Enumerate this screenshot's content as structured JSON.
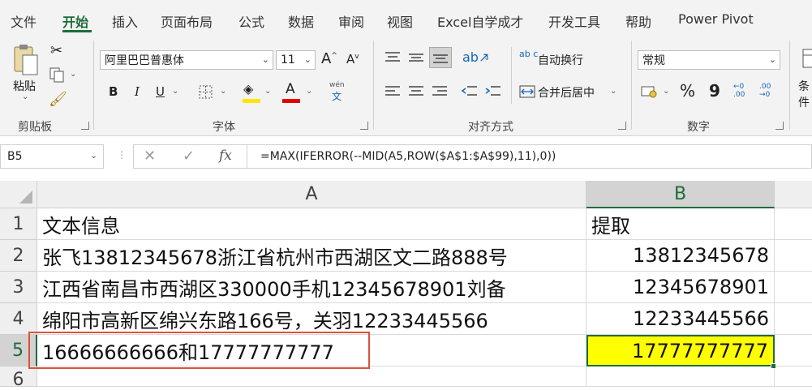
{
  "tabs": [
    "文件",
    "开始",
    "插入",
    "页面布局",
    "公式",
    "数据",
    "审阅",
    "视图",
    "Excel自学成才",
    "开发工具",
    "帮助",
    "Power Pivot"
  ],
  "clipboard": {
    "paste_label": "粘贴",
    "group_label": "剪贴板"
  },
  "font": {
    "name": "阿里巴巴普惠体",
    "size": "11",
    "group_label": "字体",
    "bold": "B",
    "italic": "I",
    "underline": "U",
    "wen": "wén",
    "wen_char": "文",
    "grow": "A",
    "shrink": "A",
    "color_a": "A"
  },
  "alignment": {
    "wrap_label": "自动换行",
    "merge_label": "合并后居中",
    "group_label": "对齐方式",
    "wrap_icon": "ab c"
  },
  "number": {
    "format": "常规",
    "group_label": "数字",
    "percent": "%",
    "comma": "9",
    "inc_dec": "←0 .00",
    "dec_dec": ".00 →0"
  },
  "conditional": {
    "label": "条件"
  },
  "formula_bar": {
    "name_box": "B5",
    "formula": "=MAX(IFERROR(--MID(A5,ROW($A$1:$A$99),11),0))",
    "cancel": "✕",
    "enter": "✓",
    "fx": "fx"
  },
  "columns": [
    "A",
    "B"
  ],
  "rows": [
    {
      "num": "1",
      "a": "文本信息",
      "b": "提取"
    },
    {
      "num": "2",
      "a": "张飞13812345678浙江省杭州市西湖区文二路888号",
      "b": "13812345678"
    },
    {
      "num": "3",
      "a": "江西省南昌市西湖区330000手机12345678901刘备",
      "b": "12345678901"
    },
    {
      "num": "4",
      "a": "绵阳市高新区绵兴东路166号，关羽12233445566",
      "b": "12233445566"
    },
    {
      "num": "5",
      "a": "16666666666和17777777777",
      "b": "17777777777"
    },
    {
      "num": "6",
      "a": "",
      "b": ""
    }
  ],
  "colors": {
    "accent": "#1e6c3b",
    "highlight": "#ffff00",
    "red_box": "#d9533b",
    "underline_yellow": "#ffe600",
    "underline_red": "#e00000"
  }
}
